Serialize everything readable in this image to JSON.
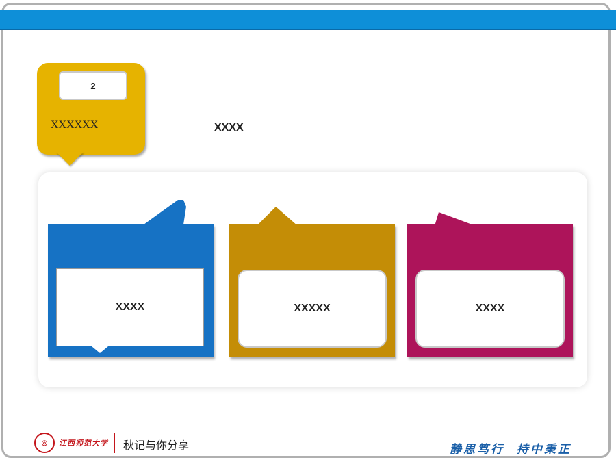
{
  "badge": {
    "number": "2",
    "label": "XXXXXX"
  },
  "intro": {
    "text": "XXXX"
  },
  "cards": [
    {
      "text": "XXXX",
      "color": "#1672c4"
    },
    {
      "text": "XXXXX",
      "color": "#c48d06"
    },
    {
      "text": "XXXX",
      "color": "#ad145a"
    }
  ],
  "footer": {
    "university": "江西师范大学",
    "caption": "秋记与你分享",
    "motto": "静思笃行  持中秉正"
  },
  "colors": {
    "top_bar": "#0e8fd8",
    "badge": "#e6b300",
    "logo": "#c4161c",
    "motto": "#1a5fa8"
  }
}
